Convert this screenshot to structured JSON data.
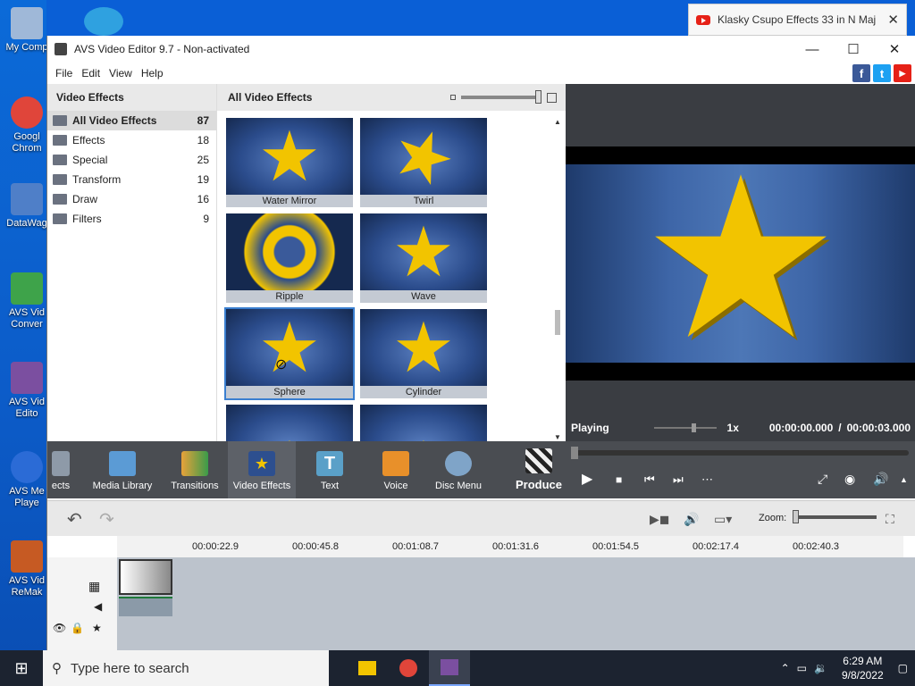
{
  "desktop": {
    "icons": [
      {
        "label": "My Comp",
        "color": "#9fb8d8"
      },
      {
        "label": "Googl Chrom",
        "color": "#e0453a"
      },
      {
        "label": "DataWag",
        "color": "#4f7fc8"
      },
      {
        "label": "AVS Vid Conver",
        "color": "#3ea34a"
      },
      {
        "label": "AVS Vid Edito",
        "color": "#7b4fa0"
      },
      {
        "label": "AVS Me Playe",
        "color": "#2b6bd6"
      },
      {
        "label": "AVS Vid ReMak",
        "color": "#c65a23"
      }
    ]
  },
  "notification": {
    "title": "Klasky Csupo Effects 33 in N Maj",
    "close": "✕"
  },
  "window": {
    "title": "AVS Video Editor 9.7 - Non-activated",
    "controls": {
      "minimize": "—",
      "maximize": "☐",
      "close": "✕"
    }
  },
  "menu": [
    "File",
    "Edit",
    "View",
    "Help"
  ],
  "social": [
    {
      "label": "f",
      "color": "#3b5998"
    },
    {
      "label": "t",
      "color": "#1da1f2"
    },
    {
      "label": "▶",
      "color": "#e62117"
    }
  ],
  "left_panel": {
    "header": "Video Effects",
    "categories": [
      {
        "name": "All Video Effects",
        "count": "87"
      },
      {
        "name": "Effects",
        "count": "18"
      },
      {
        "name": "Special",
        "count": "25"
      },
      {
        "name": "Transform",
        "count": "19"
      },
      {
        "name": "Draw",
        "count": "16"
      },
      {
        "name": "Filters",
        "count": "9"
      }
    ]
  },
  "effects_grid": {
    "header": "All Video Effects",
    "effects": [
      {
        "label": "Water Mirror"
      },
      {
        "label": "Twirl"
      },
      {
        "label": "Ripple"
      },
      {
        "label": "Wave"
      },
      {
        "label": "Sphere"
      },
      {
        "label": "Cylinder"
      },
      {
        "label": ""
      },
      {
        "label": ""
      }
    ]
  },
  "preview": {
    "status": "Playing",
    "speed": "1x",
    "time_current": "00:00:00.000",
    "time_separator": "/",
    "time_total": "00:00:03.000"
  },
  "toolbar": [
    {
      "label": "ects",
      "color": "#8e9aa8"
    },
    {
      "label": "Media Library",
      "color": "#5b9bd5"
    },
    {
      "label": "Transitions",
      "color": "#e8a23a"
    },
    {
      "label": "Video Effects",
      "color": "#2d4f8f"
    },
    {
      "label": "Text",
      "color": "#5aa0c8"
    },
    {
      "label": "Voice",
      "color": "#e8902a"
    },
    {
      "label": "Disc Menu",
      "color": "#7fa4c8"
    },
    {
      "label": "Produce",
      "color": "#333333"
    }
  ],
  "playback": {
    "play": "▶",
    "stop": "■",
    "prev": "⏮",
    "next": "⏭",
    "more": "⋯"
  },
  "editbar": {
    "zoom_label": "Zoom:"
  },
  "ruler": [
    "00:00:22.9",
    "00:00:45.8",
    "00:01:08.7",
    "00:01:31.6",
    "00:01:54.5",
    "00:02:17.4",
    "00:02:40.3"
  ],
  "taskbar": {
    "search_placeholder": "Type here to search",
    "time": "6:29 AM",
    "date": "9/8/2022"
  }
}
